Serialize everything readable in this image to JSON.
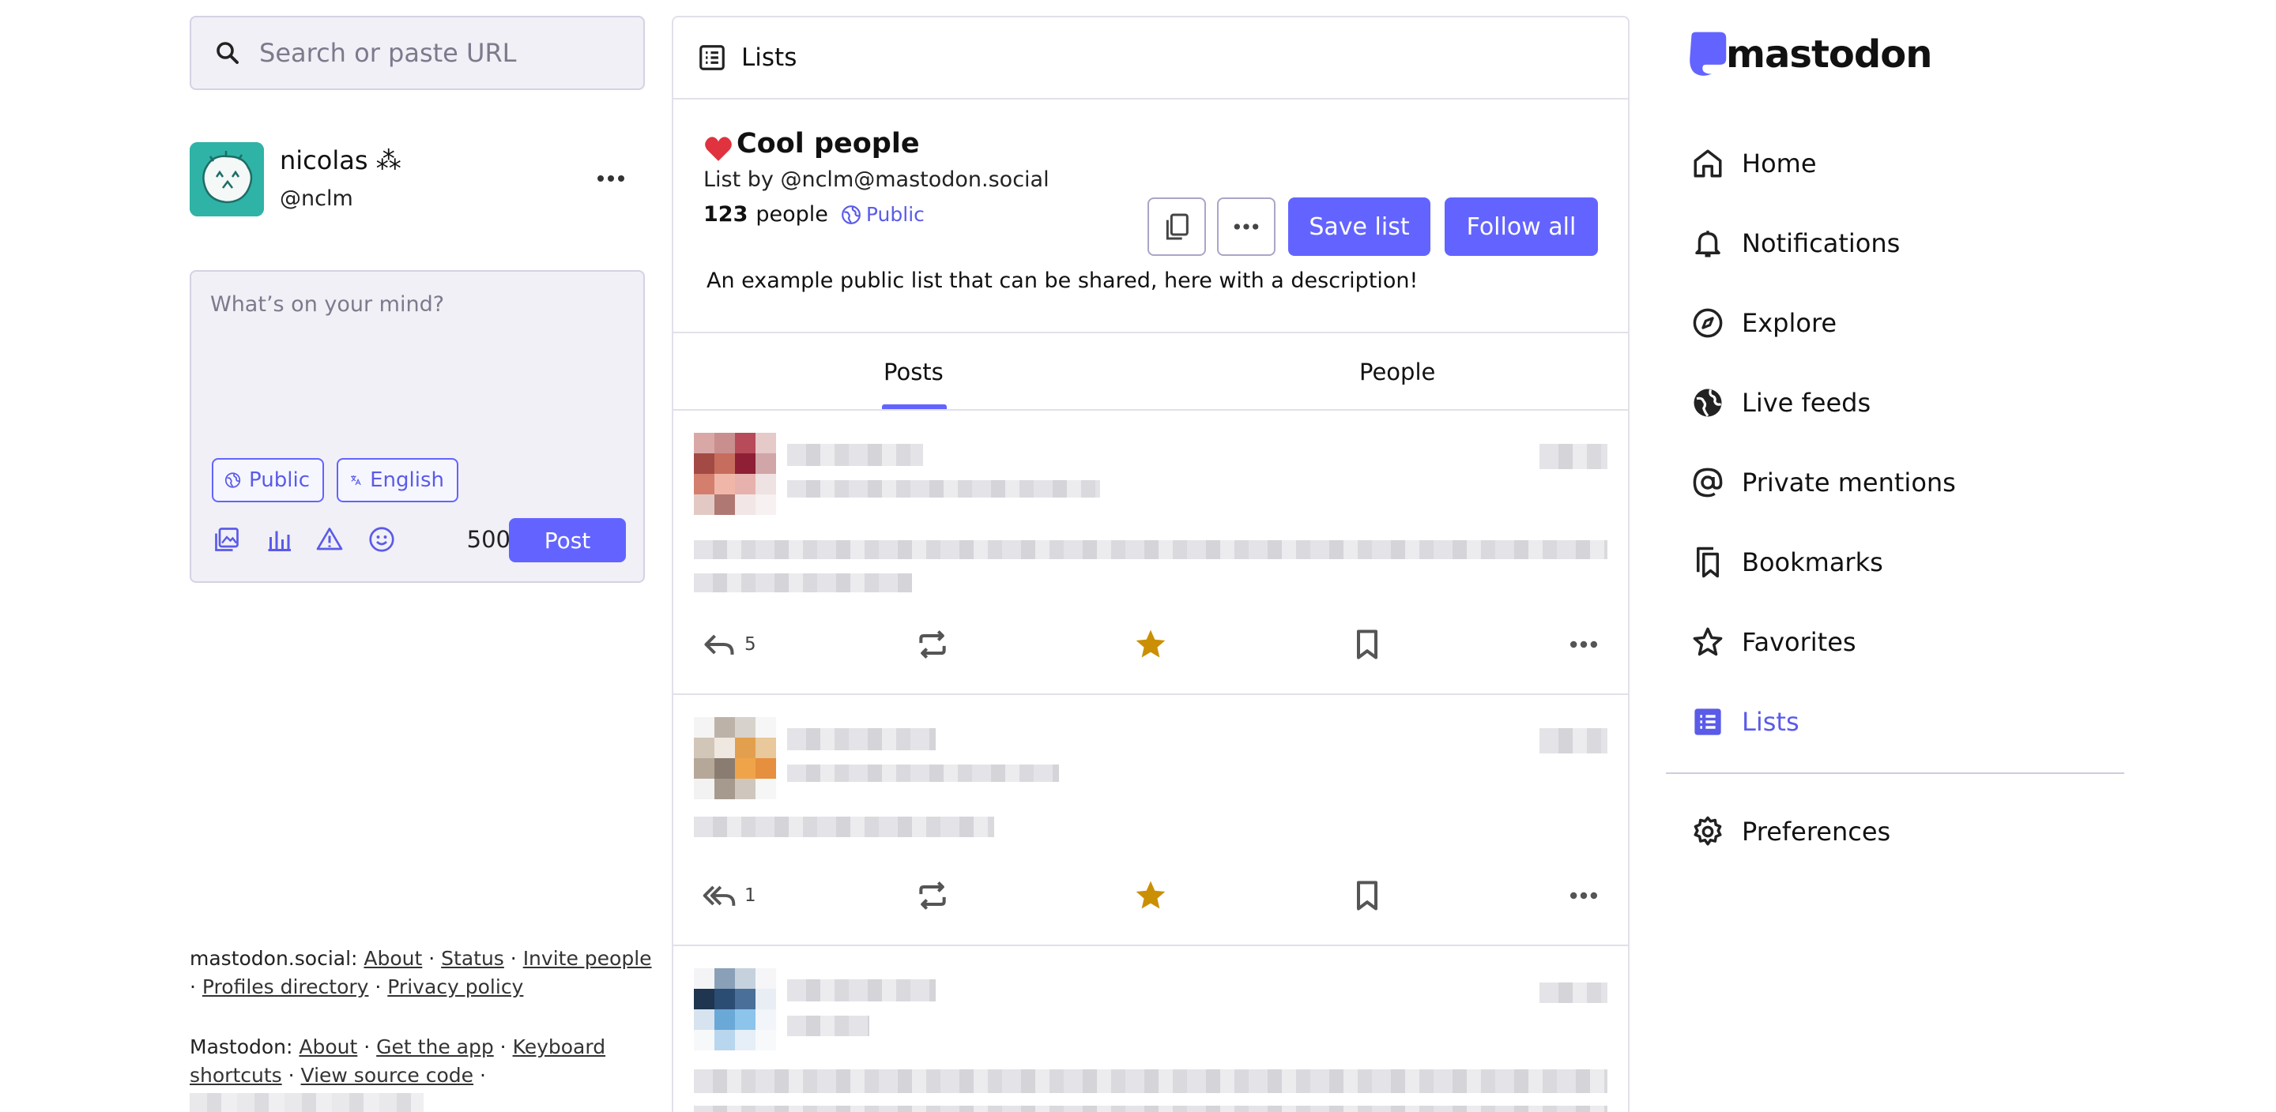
{
  "search": {
    "placeholder": "Search or paste URL"
  },
  "account": {
    "display_name": "nicolas ⁂",
    "handle": "@nclm"
  },
  "composer": {
    "placeholder": "What’s on your mind?",
    "visibility": "Public",
    "language": "English",
    "char_count": "500",
    "post_label": "Post"
  },
  "footer": {
    "server_label": "mastodon.social",
    "server_links": [
      "About",
      "Status",
      "Invite people",
      "Profiles directory",
      "Privacy policy"
    ],
    "mastodon_label": "Mastodon",
    "mastodon_links": [
      "About",
      "Get the app",
      "Keyboard shortcuts",
      "View source code"
    ]
  },
  "column": {
    "title": "Lists"
  },
  "list": {
    "name": "Cool people",
    "byline": "List by @nclm@mastodon.social",
    "count": "123",
    "count_label": "people",
    "visibility": "Public",
    "description": "An example public list that can be shared, here with a description!",
    "save_label": "Save list",
    "follow_label": "Follow all"
  },
  "tabs": [
    "Posts",
    "People"
  ],
  "posts": [
    {
      "replies": "5",
      "favourited": true
    },
    {
      "replies": "1",
      "favourited": true
    }
  ],
  "brand": {
    "name": "mastodon",
    "accent": "#6364ff",
    "star": "#ca8f04",
    "heart": "#e0323f"
  },
  "nav": {
    "items": [
      "Home",
      "Notifications",
      "Explore",
      "Live feeds",
      "Private mentions",
      "Bookmarks",
      "Favorites",
      "Lists"
    ],
    "active": "Lists",
    "preferences": "Preferences"
  }
}
